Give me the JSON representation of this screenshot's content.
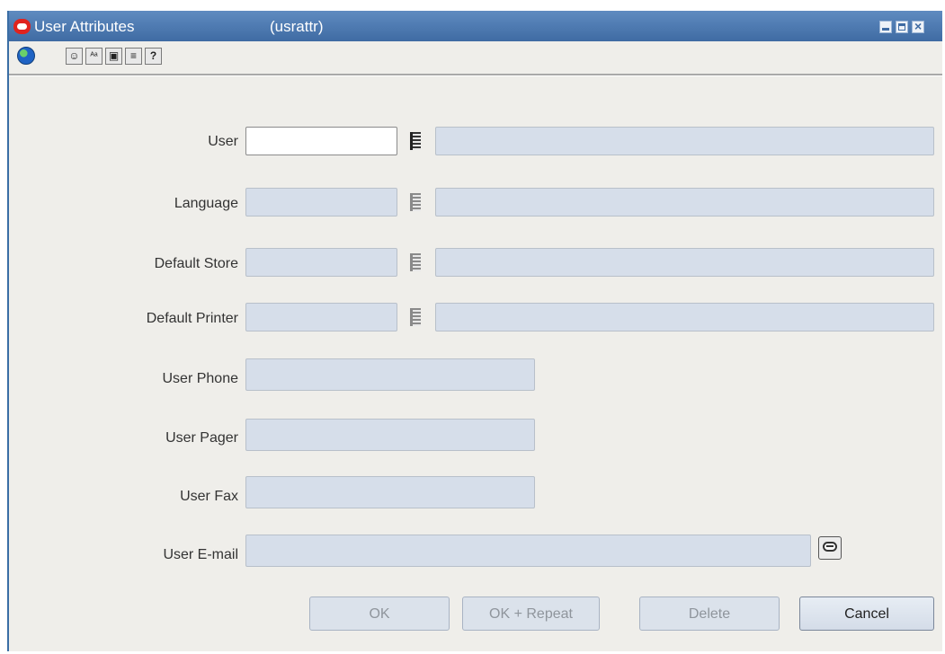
{
  "window": {
    "title": "User Attributes",
    "code": "(usrattr)",
    "close_glyph": "×"
  },
  "toolbar": {
    "buttons": [
      {
        "name": "globe-icon"
      },
      {
        "name": "smile-icon",
        "glyph": "☺"
      },
      {
        "name": "spellcheck-icon",
        "glyph": "ᴬᵃ"
      },
      {
        "name": "form-icon",
        "glyph": "▣"
      },
      {
        "name": "notes-icon",
        "glyph": "≡"
      },
      {
        "name": "help-icon",
        "glyph": "?"
      }
    ]
  },
  "form": {
    "user": {
      "label": "User",
      "value": "",
      "description": ""
    },
    "language": {
      "label": "Language",
      "value": "",
      "description": ""
    },
    "default_store": {
      "label": "Default Store",
      "value": "",
      "description": ""
    },
    "default_printer": {
      "label": "Default Printer",
      "value": "",
      "description": ""
    },
    "user_phone": {
      "label": "User Phone",
      "value": ""
    },
    "user_pager": {
      "label": "User Pager",
      "value": ""
    },
    "user_fax": {
      "label": "User Fax",
      "value": ""
    },
    "user_email": {
      "label": "User E-mail",
      "value": ""
    }
  },
  "actions": {
    "ok": "OK",
    "ok_repeat": "OK + Repeat",
    "delete": "Delete",
    "cancel": "Cancel"
  },
  "colors": {
    "titlebar": "#3f6ba3",
    "field_disabled": "#d6deea",
    "window_bg": "#efeeea"
  }
}
